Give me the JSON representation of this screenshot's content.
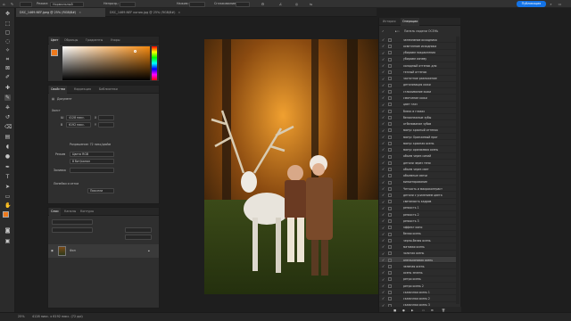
{
  "options_bar": {
    "mode_label": "Режим:",
    "mode_value": "Нормальный",
    "opacity_label": "Непрозр.:",
    "flow_label": "Нажим:",
    "smoothing_label": "Сглаживание:",
    "share_label": "Публикация"
  },
  "doc_tabs": [
    {
      "label": "DSC_1469.NEF.jpeg @ 25% (RGB/8#)"
    },
    {
      "label": "DSC_1469.NEF копия.jpg @ 25% (RGB/8#)"
    }
  ],
  "color_panel": {
    "tabs": [
      "Цвет",
      "Образцы",
      "Градиенты",
      "Узоры"
    ],
    "accent_color": "#e8821a"
  },
  "properties_panel": {
    "tabs": [
      "Свойства",
      "Коррекция",
      "Библиотеки"
    ],
    "document_label": "Документ",
    "canvas_label": "Холст",
    "width_label": "Ш",
    "width_value": "4128 пикс.",
    "height_label": "В",
    "height_value": "6192 пикс.",
    "x_label": "X",
    "y_label": "Y",
    "resolution": "Разрешение: 72 пикс/дюйм",
    "mode_label": "Режим",
    "mode_value": "Цвета RGB",
    "bit_value": "8 бит/канал",
    "fill_label": "Заливка",
    "rulers_label": "Линейки и сетки",
    "units_value": "Пиксели"
  },
  "layers_panel": {
    "tabs": [
      "Слои",
      "Каналы",
      "Контуры"
    ],
    "layer_name": "Фон"
  },
  "history_panel": {
    "tabs": [
      "История",
      "Операции"
    ],
    "set_name": "Панель модели ОСЕНЬ",
    "items": [
      "затемнение исходника",
      "осветление исходника",
      "убираем покраснения",
      "убираем синеву",
      "холодный оттенок для",
      "теплый оттенок",
      "частотное разложение",
      "детализация кожи",
      "сглаживание кожи",
      "смягчение кожи",
      "цвет глаз",
      "блеск в глазах",
      "белоснежные зубы",
      "отбеливание зубов",
      "минус красный оттенок",
      "минус Оранжевый прог",
      "минус красная осень",
      "минус оранжевая осень",
      "объем через синий",
      "детали через тени",
      "объем через свет",
      "объемные свечи",
      "виньетирование",
      "Четкость и микроконтраст",
      "детали с усилением цвета",
      "светимость кадров",
      "резкость 1",
      "резкость 2",
      "резкость 3",
      "эффект кино",
      "белая осень",
      "черно-белая осень",
      "матовая осень",
      "золотая осень",
      "апельсиновая осень",
      "зеленая осень",
      "осень зелень",
      "ретро осень",
      "ретро осень 2",
      "сказочная осень 1",
      "сказочная осень 2",
      "сказочная осень 3"
    ],
    "selected_index": 34
  },
  "status_bar": {
    "zoom": "25%",
    "doc_info": "4128 пикс. x 6192 пикс. (72 ppi)"
  }
}
